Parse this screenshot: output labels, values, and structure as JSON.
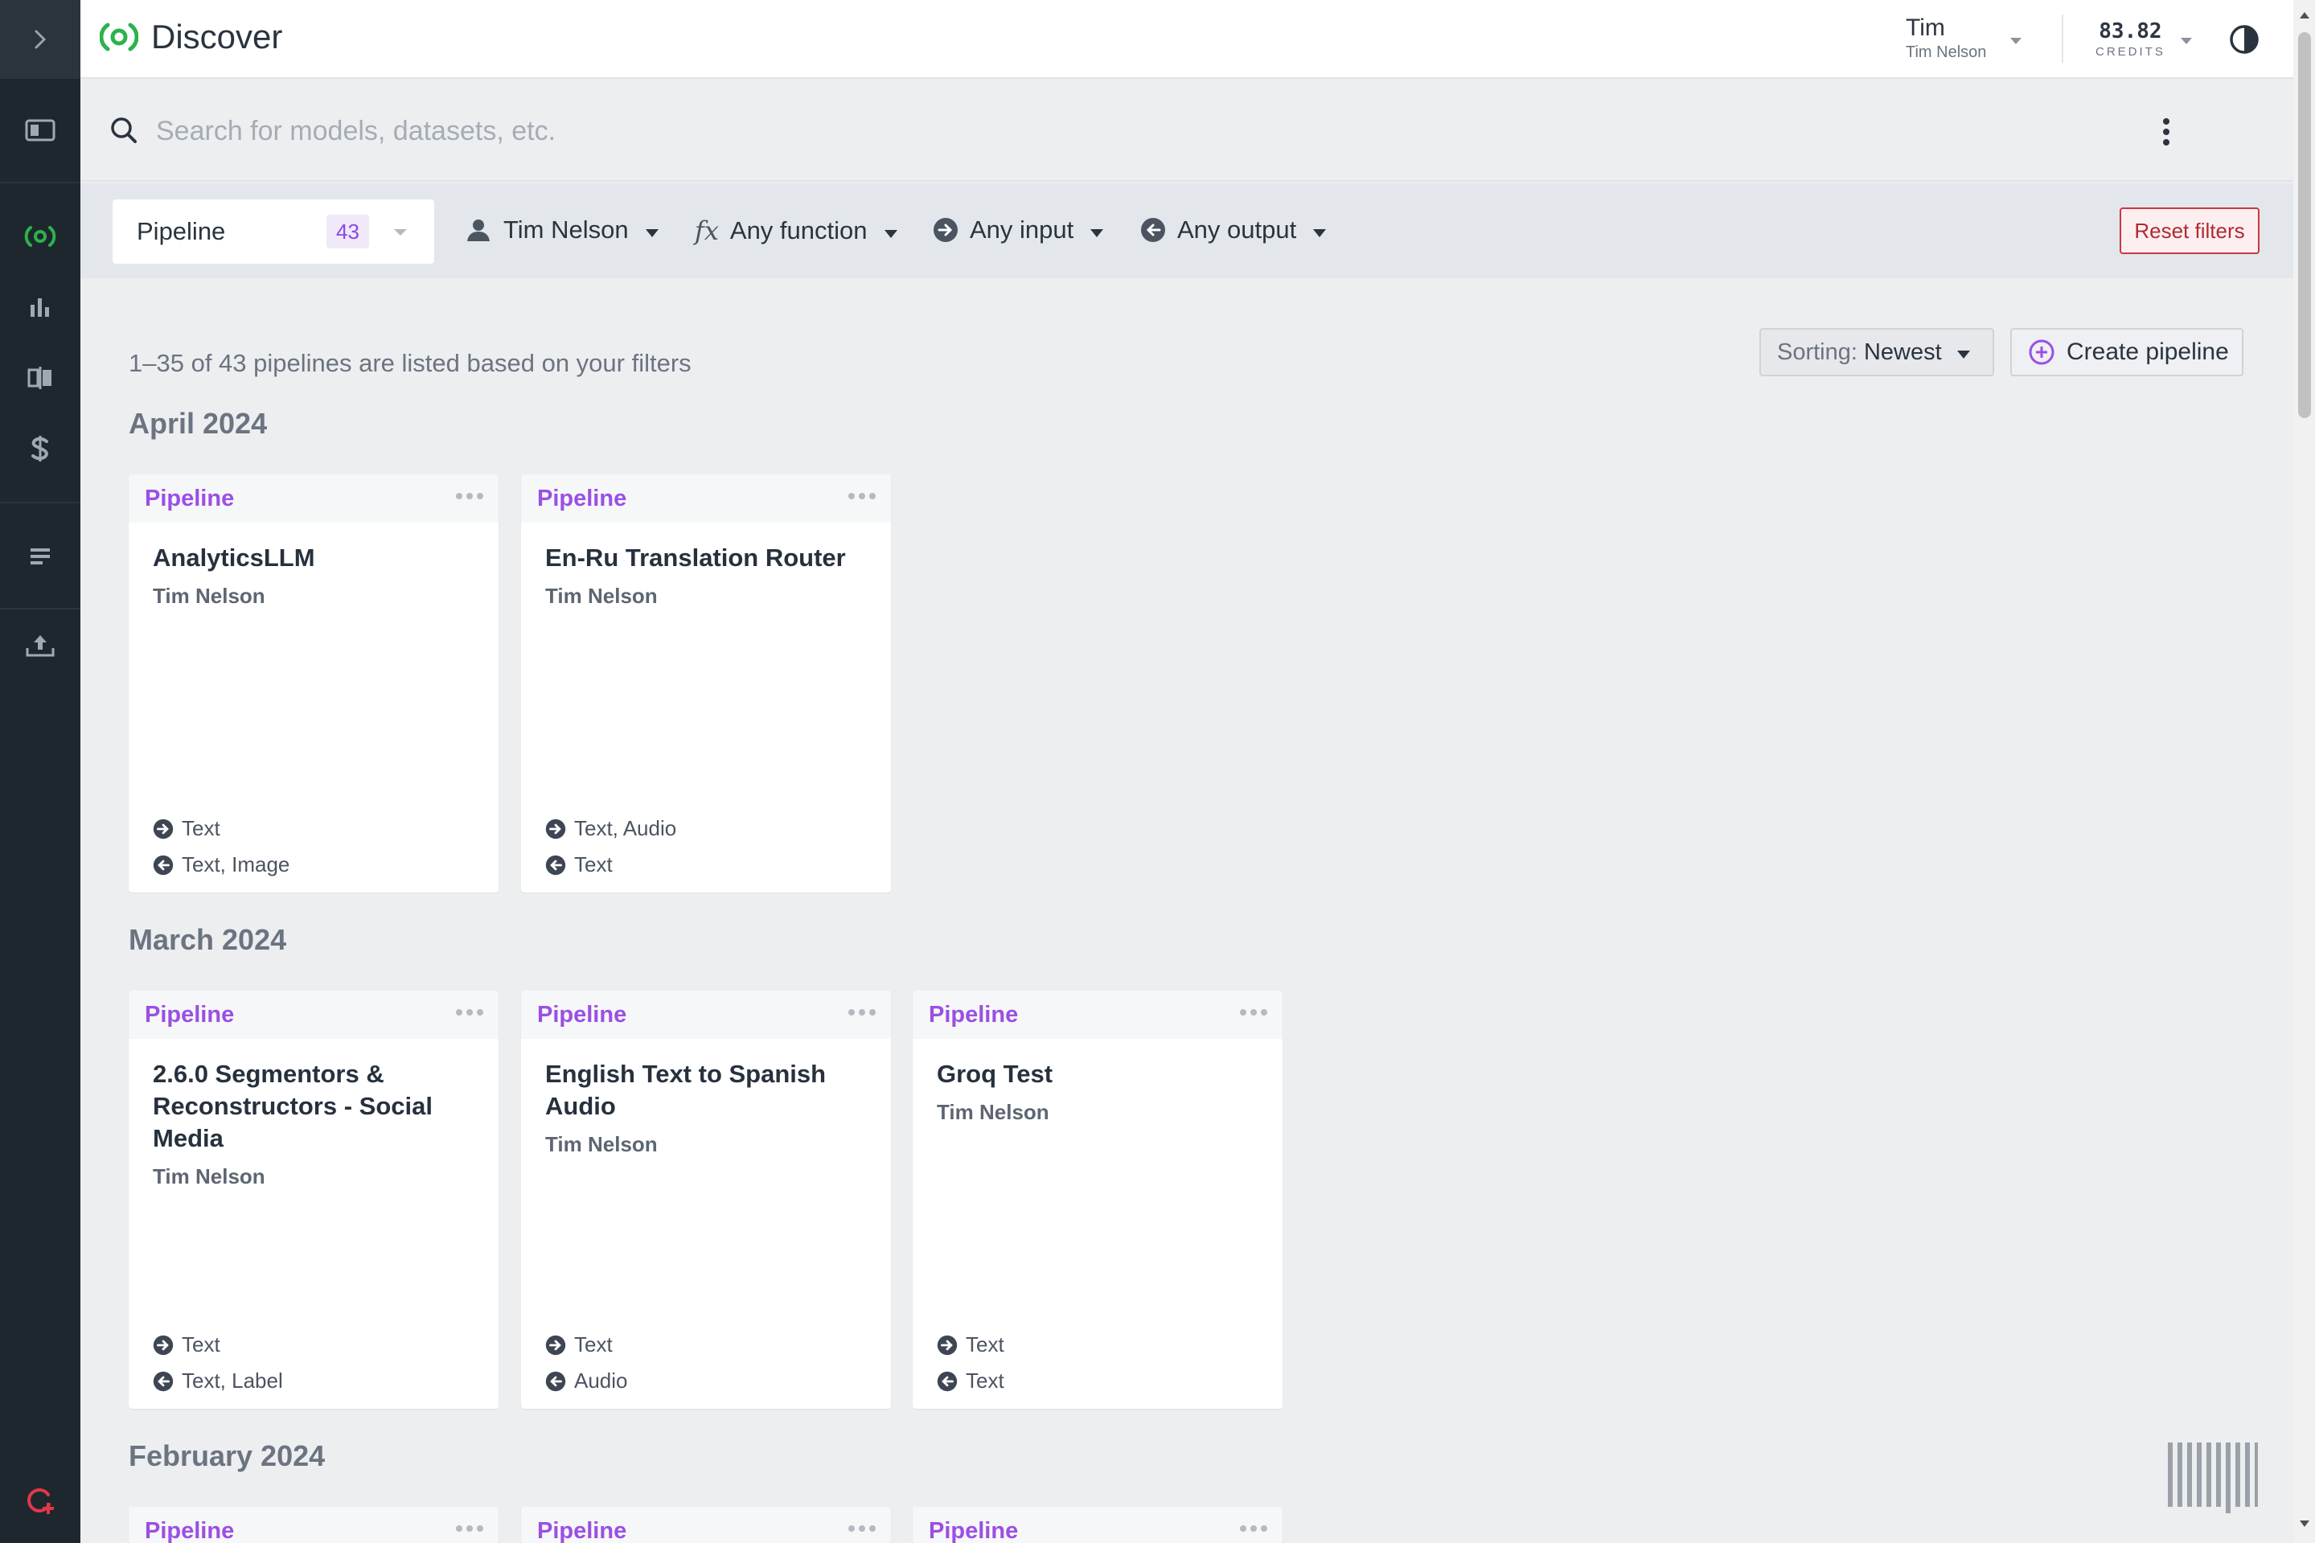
{
  "app": {
    "title": "Discover"
  },
  "user": {
    "first_name": "Tim",
    "full_name": "Tim Nelson"
  },
  "credits": {
    "value": "83.82",
    "label": "CREDITS"
  },
  "search": {
    "placeholder": "Search for models, datasets, etc."
  },
  "filters": {
    "type_label": "Pipeline",
    "type_count": "43",
    "owner": "Tim Nelson",
    "function": "Any function",
    "input": "Any input",
    "output": "Any output",
    "reset_label": "Reset filters"
  },
  "results": {
    "summary": "1–35 of 43 pipelines are listed based on your filters",
    "sorting_label": "Sorting:",
    "sorting_value": "Newest",
    "create_label": "Create pipeline"
  },
  "groups": [
    {
      "month": "April 2024",
      "cards": [
        {
          "type": "Pipeline",
          "title": "AnalyticsLLM",
          "author": "Tim Nelson",
          "input": "Text",
          "output": "Text, Image"
        },
        {
          "type": "Pipeline",
          "title": "En-Ru Translation Router",
          "author": "Tim Nelson",
          "input": "Text, Audio",
          "output": "Text"
        }
      ]
    },
    {
      "month": "March 2024",
      "cards": [
        {
          "type": "Pipeline",
          "title": "2.6.0 Segmentors & Reconstructors - Social Media",
          "author": "Tim Nelson",
          "input": "Text",
          "output": "Text, Label"
        },
        {
          "type": "Pipeline",
          "title": "English Text to Spanish Audio",
          "author": "Tim Nelson",
          "input": "Text",
          "output": "Audio"
        },
        {
          "type": "Pipeline",
          "title": "Groq Test",
          "author": "Tim Nelson",
          "input": "Text",
          "output": "Text"
        }
      ]
    },
    {
      "month": "February 2024",
      "cards": [
        {
          "type": "Pipeline"
        },
        {
          "type": "Pipeline"
        },
        {
          "type": "Pipeline"
        }
      ]
    }
  ],
  "colors": {
    "accent": "#9b4fe3",
    "brand_green": "#2bb24c",
    "sidebar_bg": "#1f272e",
    "danger": "#c9383f"
  },
  "icons": {
    "sidebar": [
      "chevron-right-icon",
      "panel-icon",
      "discover-icon",
      "chart-icon",
      "compare-icon",
      "dollar-icon",
      "list-icon",
      "upload-icon",
      "support-icon"
    ]
  }
}
